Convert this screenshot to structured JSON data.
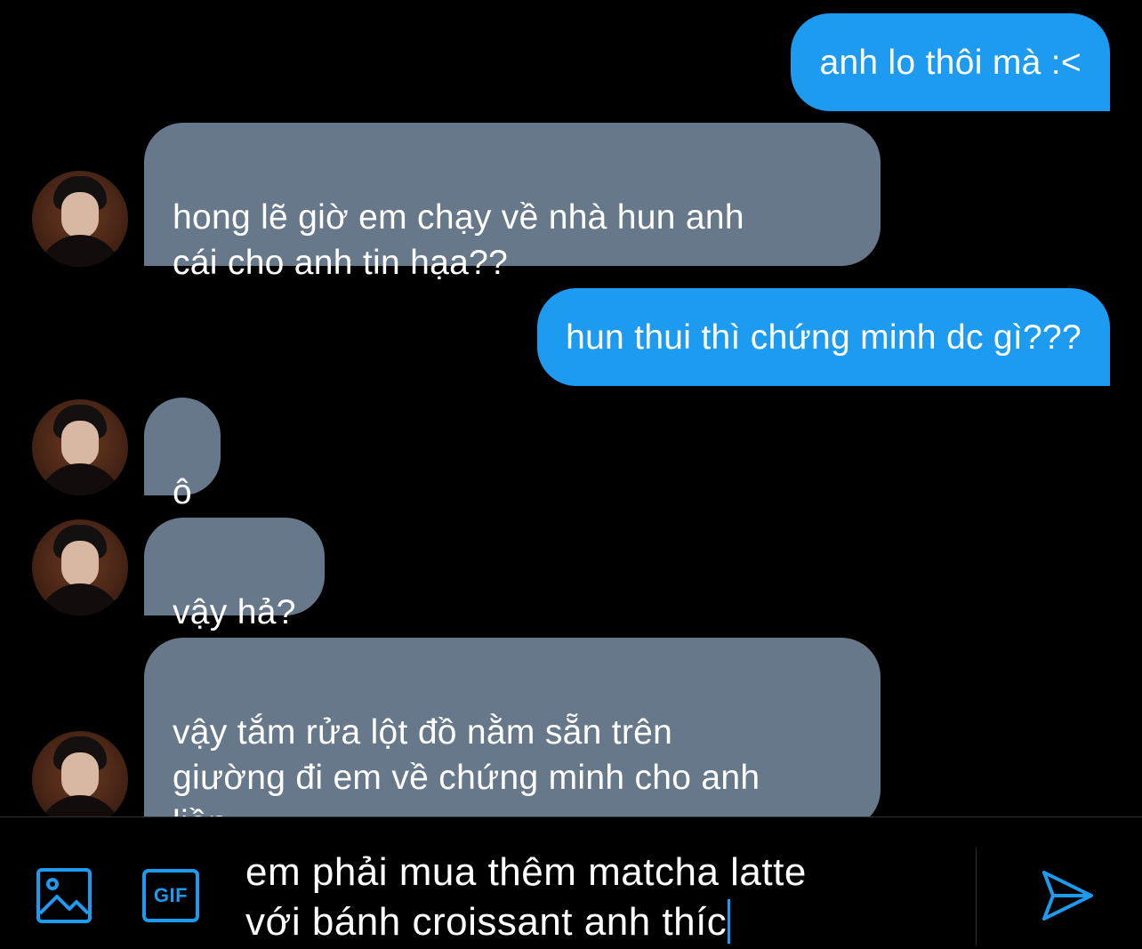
{
  "colors": {
    "background": "#000000",
    "sent_bubble": "#1d9bf0",
    "received_bubble": "#66788a",
    "accent": "#1d9bf0",
    "text": "#ffffff"
  },
  "messages": [
    {
      "direction": "sent",
      "text": "anh lo thôi mà :<"
    },
    {
      "direction": "received",
      "text": "hong lẽ giờ em chạy về nhà hun anh\ncái cho anh tin hạa??"
    },
    {
      "direction": "sent",
      "text": "hun thui thì chứng minh dc gì???"
    },
    {
      "direction": "received",
      "text": "ô"
    },
    {
      "direction": "received",
      "text": "vậy hả?"
    },
    {
      "direction": "received",
      "text": "vậy tắm rửa lột đồ nằm sẵn trên\ngiường đi em về chứng minh cho anh\nliền"
    }
  ],
  "composer": {
    "media_icon": "image-icon",
    "gif_icon": "gif-icon",
    "gif_label": "GIF",
    "draft_text": "em phải mua thêm matcha latte\nvới bánh croissant anh thíc",
    "send_icon": "send-icon"
  }
}
